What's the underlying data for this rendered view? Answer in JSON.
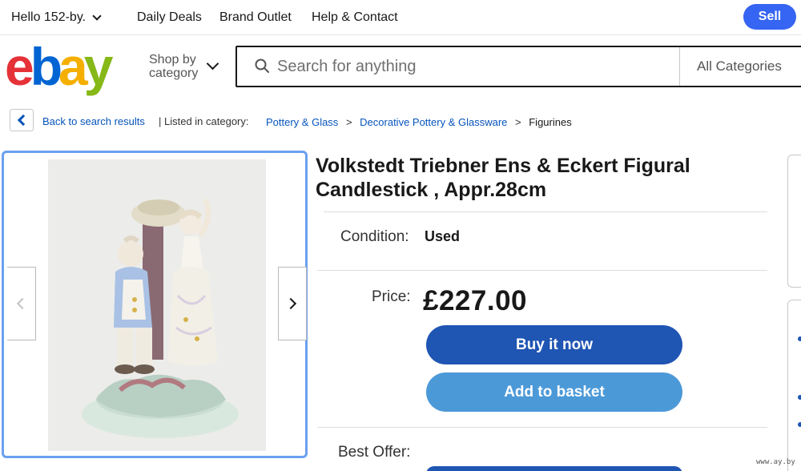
{
  "topbar": {
    "greeting": "Hello 152-by.",
    "links": [
      "Daily Deals",
      "Brand Outlet",
      "Help & Contact"
    ],
    "sell_label": "Sell"
  },
  "header": {
    "logo_letters": [
      "e",
      "b",
      "a",
      "y"
    ],
    "shop_by_line1": "Shop by",
    "shop_by_line2": "category",
    "search_placeholder": "Search for anything",
    "category_select": "All Categories"
  },
  "breadcrumb": {
    "back_label": "Back to search results",
    "listed_label": "| Listed in category:",
    "path": [
      "Pottery & Glass",
      "Decorative Pottery & Glassware",
      "Figurines"
    ],
    "separator": ">"
  },
  "item": {
    "title": "Volkstedt Triebner Ens & Eckert Figural Candlestick , Appr.28cm",
    "condition_label": "Condition:",
    "condition_value": "Used",
    "price_label": "Price:",
    "price_value": "£227.00",
    "buy_now_label": "Buy it now",
    "add_basket_label": "Add to basket",
    "best_offer_label": "Best Offer:"
  },
  "watermark": "www.ay.by",
  "colors": {
    "ebay_red": "#e53238",
    "ebay_blue": "#0064d2",
    "ebay_yellow": "#f5af02",
    "ebay_green": "#86b817",
    "primary_button": "#1f55b3",
    "secondary_button": "#4c99d8",
    "link": "#0654ba"
  }
}
